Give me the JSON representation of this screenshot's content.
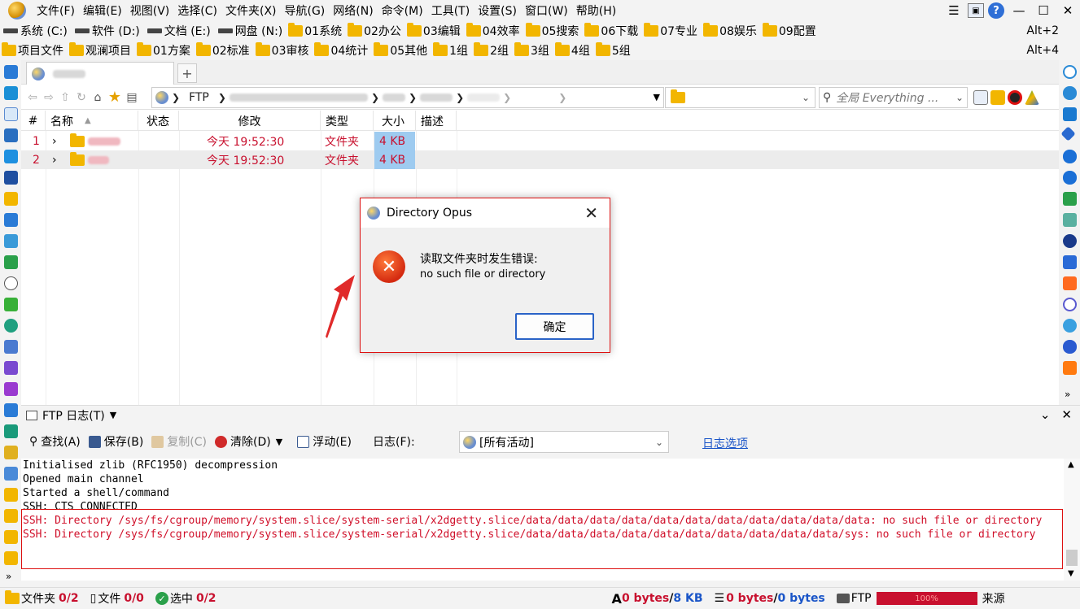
{
  "menubar": {
    "items": [
      "文件(F)",
      "编辑(E)",
      "视图(V)",
      "选择(C)",
      "文件夹(X)",
      "导航(G)",
      "网络(N)",
      "命令(M)",
      "工具(T)",
      "设置(S)",
      "窗口(W)",
      "帮助(H)"
    ],
    "help_glyph": "?",
    "minimize": "—",
    "maximize": "☐",
    "close": "✕"
  },
  "drives_bar": {
    "items": [
      "系统 (C:)",
      "软件 (D:)",
      "文档 (E:)",
      "网盘 (N:)",
      "01系统",
      "02办公",
      "03编辑",
      "04效率",
      "05搜索",
      "06下载",
      "07专业",
      "08娱乐",
      "09配置"
    ],
    "hotkey": "Alt+2"
  },
  "projects_bar": {
    "items": [
      "项目文件",
      "观澜项目",
      "01方案",
      "02标准",
      "03审核",
      "04统计",
      "05其他",
      "1组",
      "2组",
      "3组",
      "4组",
      "5组"
    ],
    "hotkey": "Alt+4"
  },
  "tabs": {
    "add": "+"
  },
  "address": {
    "crumbs": [
      "FTP"
    ],
    "search_placeholder": "全局 Everything ..."
  },
  "file_list": {
    "columns": [
      "#",
      "名称",
      "状态",
      "修改",
      "类型",
      "大小",
      "描述"
    ],
    "rows": [
      {
        "num": "1",
        "modified": "今天 19:52:30",
        "type": "文件夹",
        "size": "4 KB"
      },
      {
        "num": "2",
        "modified": "今天 19:52:30",
        "type": "文件夹",
        "size": "4 KB"
      }
    ]
  },
  "dialog": {
    "title": "Directory Opus",
    "message": "读取文件夹时发生错误:",
    "detail": "no such file or directory",
    "ok_label": "确定",
    "close": "✕"
  },
  "log_panel": {
    "title": "FTP 日志(T)",
    "find": "查找(A)",
    "save": "保存(B)",
    "copy": "复制(C)",
    "clear": "清除(D)",
    "float": "浮动(E)",
    "log_label": "日志(F):",
    "log_filter": "[所有活动]",
    "options_link": "日志选项",
    "lines": [
      "Initialised zlib (RFC1950) decompression",
      "Opened main channel",
      "Started a shell/command",
      "SSH: CTS CONNECTED"
    ],
    "error_lines": [
      "SSH: Directory /sys/fs/cgroup/memory/system.slice/system-serial/x2dgetty.slice/data/data/data/data/data/data/data/data/data/data/data: no such file or directory",
      "SSH: Directory /sys/fs/cgroup/memory/system.slice/system-serial/x2dgetty.slice/data/data/data/data/data/data/data/data/data/data/sys: no such file or directory"
    ]
  },
  "status_bar": {
    "folders_label": "文件夹",
    "folders_value": "0/2",
    "files_label": "文件",
    "files_value": "0/0",
    "selected_label": "选中",
    "selected_value": "0/2",
    "bytes_a": "0 bytes",
    "bytes_a_total": "8 KB",
    "bytes_b": "0 bytes",
    "bytes_b_total": "0 bytes",
    "ftp_label": "FTP",
    "progress_text": "100%",
    "source_label": "来源"
  },
  "colors": {
    "accent": "#1a55c8",
    "error": "#c8102e",
    "folder": "#f2b600"
  }
}
